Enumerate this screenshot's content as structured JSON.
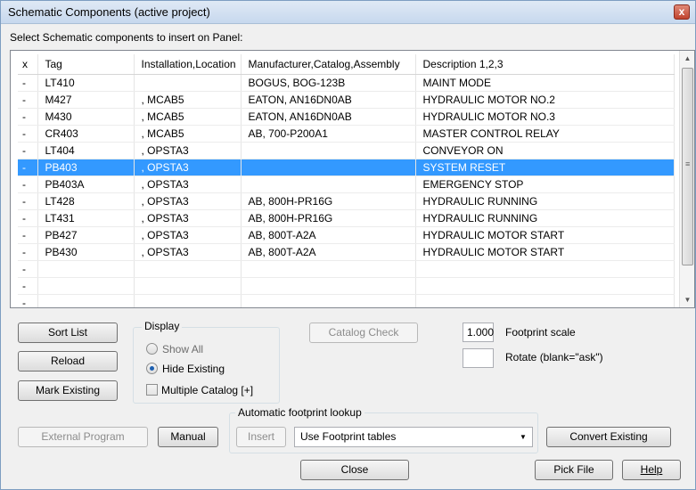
{
  "window": {
    "title": "Schematic Components (active project)",
    "close_glyph": "x",
    "subtitle": "Select Schematic components to insert on Panel:"
  },
  "grid": {
    "columns": [
      "x",
      "Tag",
      "Installation,Location",
      "Manufacturer,Catalog,Assembly",
      "Description 1,2,3"
    ],
    "rows": [
      {
        "x": "-",
        "tag": "LT410",
        "loc": "",
        "mfr": "BOGUS, BOG-123B",
        "desc": "MAINT MODE",
        "selected": false
      },
      {
        "x": "-",
        "tag": "M427",
        "loc": ", MCAB5",
        "mfr": "EATON, AN16DN0AB",
        "desc": "HYDRAULIC MOTOR NO.2",
        "selected": false
      },
      {
        "x": "-",
        "tag": "M430",
        "loc": ", MCAB5",
        "mfr": "EATON, AN16DN0AB",
        "desc": "HYDRAULIC MOTOR NO.3",
        "selected": false
      },
      {
        "x": "-",
        "tag": "CR403",
        "loc": ", MCAB5",
        "mfr": "AB, 700-P200A1",
        "desc": "MASTER CONTROL RELAY",
        "selected": false
      },
      {
        "x": "-",
        "tag": "LT404",
        "loc": ", OPSTA3",
        "mfr": "",
        "desc": "CONVEYOR ON",
        "selected": false
      },
      {
        "x": "-",
        "tag": "PB403",
        "loc": ", OPSTA3",
        "mfr": "",
        "desc": "SYSTEM RESET",
        "selected": true
      },
      {
        "x": "-",
        "tag": "PB403A",
        "loc": ", OPSTA3",
        "mfr": "",
        "desc": "EMERGENCY STOP",
        "selected": false
      },
      {
        "x": "-",
        "tag": "LT428",
        "loc": ", OPSTA3",
        "mfr": "AB, 800H-PR16G",
        "desc": "HYDRAULIC RUNNING",
        "selected": false
      },
      {
        "x": "-",
        "tag": "LT431",
        "loc": ", OPSTA3",
        "mfr": "AB, 800H-PR16G",
        "desc": "HYDRAULIC RUNNING",
        "selected": false
      },
      {
        "x": "-",
        "tag": "PB427",
        "loc": ", OPSTA3",
        "mfr": "AB, 800T-A2A",
        "desc": "HYDRAULIC MOTOR START",
        "selected": false
      },
      {
        "x": "-",
        "tag": "PB430",
        "loc": ", OPSTA3",
        "mfr": "AB, 800T-A2A",
        "desc": "HYDRAULIC MOTOR START",
        "selected": false
      },
      {
        "x": "-",
        "tag": "",
        "loc": "",
        "mfr": "",
        "desc": "",
        "selected": false
      },
      {
        "x": "-",
        "tag": "",
        "loc": "",
        "mfr": "",
        "desc": "",
        "selected": false
      },
      {
        "x": "-",
        "tag": "",
        "loc": "",
        "mfr": "",
        "desc": "",
        "selected": false
      }
    ],
    "scroll_up_glyph": "▲",
    "scroll_down_glyph": "▼",
    "scroll_grip_glyph": "≡"
  },
  "buttons": {
    "sort_list": "Sort List",
    "reload": "Reload",
    "mark_existing": "Mark Existing",
    "catalog_check": "Catalog Check",
    "external_program": "External Program",
    "manual": "Manual",
    "insert": "Insert",
    "convert_existing": "Convert Existing",
    "close": "Close",
    "pick_file": "Pick File",
    "help": "Help"
  },
  "display": {
    "legend": "Display",
    "show_all": "Show All",
    "hide_existing": "Hide Existing",
    "multiple_catalog": "Multiple Catalog [+]",
    "selected": "Hide Existing"
  },
  "footprint": {
    "scale_value": "1.000",
    "scale_label": "Footprint scale",
    "rotate_value": "",
    "rotate_label": "Rotate (blank=\"ask\")"
  },
  "auto_lookup": {
    "legend": "Automatic footprint lookup",
    "combo_value": "Use Footprint tables",
    "combo_glyph": "▼"
  }
}
